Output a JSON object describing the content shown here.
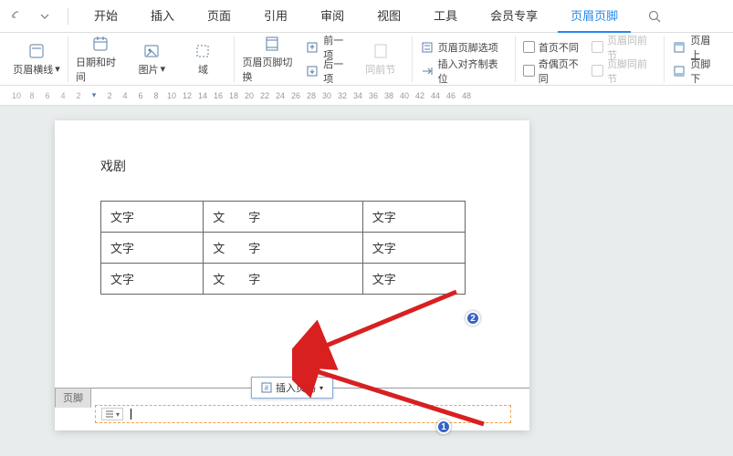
{
  "menubar": {
    "tabs": [
      "开始",
      "插入",
      "页面",
      "引用",
      "审阅",
      "视图",
      "工具",
      "会员专享",
      "页眉页脚"
    ],
    "active_index": 8
  },
  "ribbon": {
    "header_line": {
      "label": "页眉横线",
      "dd": "▾"
    },
    "datetime": {
      "label": "日期和时间"
    },
    "picture": {
      "label": "图片",
      "dd": "▾"
    },
    "field": {
      "label": "域"
    },
    "switch": {
      "label": "页眉页脚切换"
    },
    "prev": {
      "label": "前一项"
    },
    "next": {
      "label": "后一项"
    },
    "same_section": {
      "label": "同前节"
    },
    "hf_options": {
      "label": "页眉页脚选项"
    },
    "insert_tab": {
      "label": "插入对齐制表位"
    },
    "first_diff": {
      "label": "首页不同"
    },
    "odd_even": {
      "label": "奇偶页不同"
    },
    "hdr_same": {
      "label": "页眉同前节"
    },
    "ftr_same": {
      "label": "页脚同前节"
    },
    "hdr_top": {
      "label": "页眉上"
    },
    "ftr_bottom": {
      "label": "页脚下"
    }
  },
  "ruler": {
    "neg": [
      "10",
      "8",
      "6",
      "4",
      "2"
    ],
    "pos": [
      "2",
      "4",
      "6",
      "8",
      "10",
      "12",
      "14",
      "16",
      "18",
      "20",
      "22",
      "24",
      "26",
      "28",
      "30",
      "32",
      "34",
      "36",
      "38",
      "40",
      "42",
      "44",
      "46",
      "48"
    ]
  },
  "document": {
    "header_text": "戏剧",
    "table": [
      [
        "文字",
        "文　　字",
        "文字"
      ],
      [
        "文字",
        "文　　字",
        "文字"
      ],
      [
        "文字",
        "文　　字",
        "文字"
      ]
    ],
    "footer_tab": "页脚",
    "insert_page_number": "插入页码",
    "insert_dd": "▾"
  },
  "badges": {
    "one": "1",
    "two": "2"
  }
}
